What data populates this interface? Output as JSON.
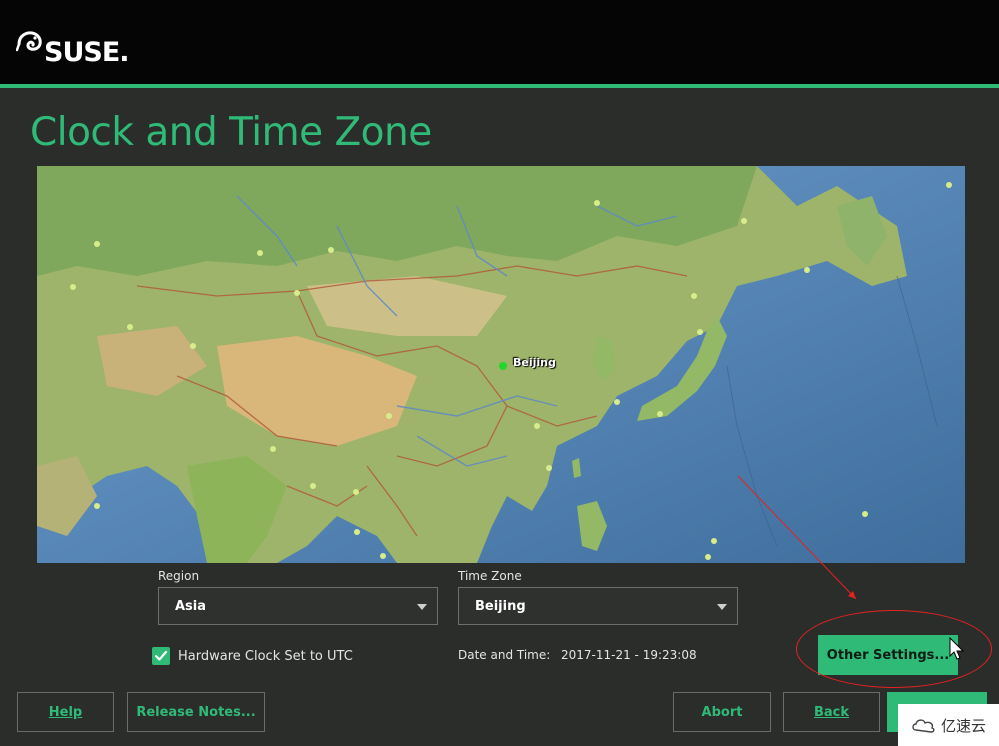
{
  "brand": {
    "logo_text": "SUSE",
    "logo_dot": ".",
    "icon": "chameleon-icon"
  },
  "page": {
    "title": "Clock and Time Zone"
  },
  "map": {
    "selected_city": "Beijing"
  },
  "region": {
    "label": "Region",
    "value": "Asia"
  },
  "timezone": {
    "label": "Time Zone",
    "value": "Beijing"
  },
  "hardware_clock": {
    "label": "Hardware Clock Set to UTC",
    "checked": true
  },
  "datetime": {
    "label": "Date and Time:",
    "value": "2017-11-21 - 19:23:08"
  },
  "buttons": {
    "other_settings": "Other Settings...",
    "help": "Help",
    "release_notes": "Release Notes...",
    "abort": "Abort",
    "back": "Back",
    "next": ""
  },
  "watermark": {
    "text": "亿速云"
  },
  "colors": {
    "accent": "#30ba78",
    "background": "#2b2d2b",
    "annotation": "#e32222"
  }
}
